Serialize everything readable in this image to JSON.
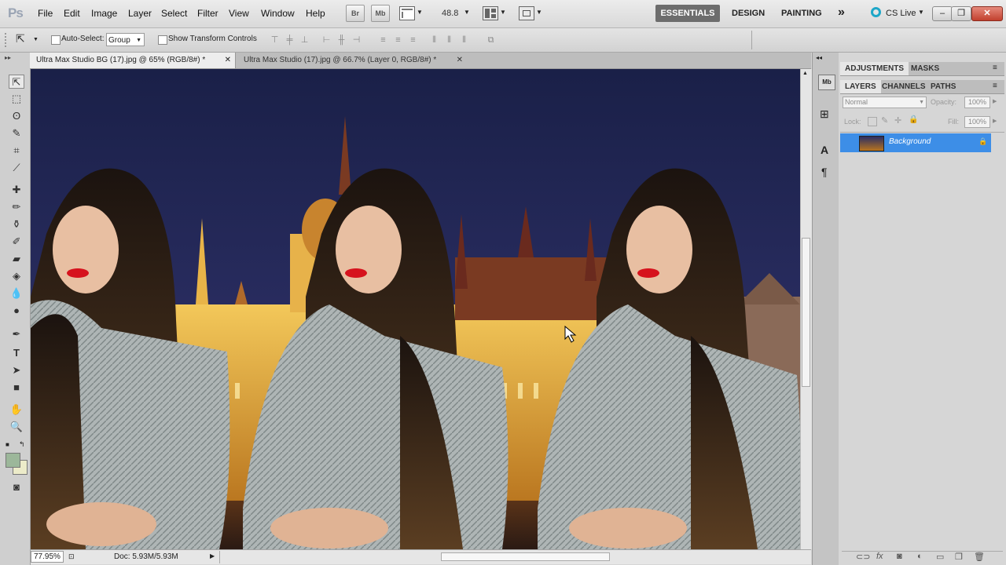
{
  "menubar": {
    "logo": "Ps",
    "items": [
      "File",
      "Edit",
      "Image",
      "Layer",
      "Select",
      "Filter",
      "View",
      "Window",
      "Help"
    ],
    "mini_buttons": [
      "Br",
      "Mb"
    ],
    "zoom": "48.8",
    "workspaces": {
      "active": "ESSENTIALS",
      "others": [
        "DESIGN",
        "PAINTING"
      ],
      "more": "»"
    },
    "cs_live": "CS Live"
  },
  "options": {
    "auto_select_label": "Auto-Select:",
    "auto_select_value": "Group",
    "show_transform_label": "Show Transform Controls"
  },
  "tabs": [
    {
      "label": "Ultra Max Studio BG (17).jpg @ 65% (RGB/8#) *",
      "active": true
    },
    {
      "label": "Ultra Max Studio (17).jpg @ 66.7% (Layer 0, RGB/8#) *",
      "active": false
    }
  ],
  "status": {
    "zoom": "77.95%",
    "doc": "Doc: 5.93M/5.93M"
  },
  "panels": {
    "top_tabs": [
      "ADJUSTMENTS",
      "MASKS"
    ],
    "layer_tabs": [
      "LAYERS",
      "CHANNELS",
      "PATHS"
    ],
    "blend_mode": "Normal",
    "opacity_label": "Opacity:",
    "opacity_value": "100%",
    "lock_label": "Lock:",
    "fill_label": "Fill:",
    "fill_value": "100%",
    "layer_name": "Background"
  },
  "colors": {
    "accent": "#3d8ee7",
    "canvas_sky": "#1e2550",
    "foreground_swatch": "#9cb79a",
    "background_swatch": "#ecebc9"
  }
}
